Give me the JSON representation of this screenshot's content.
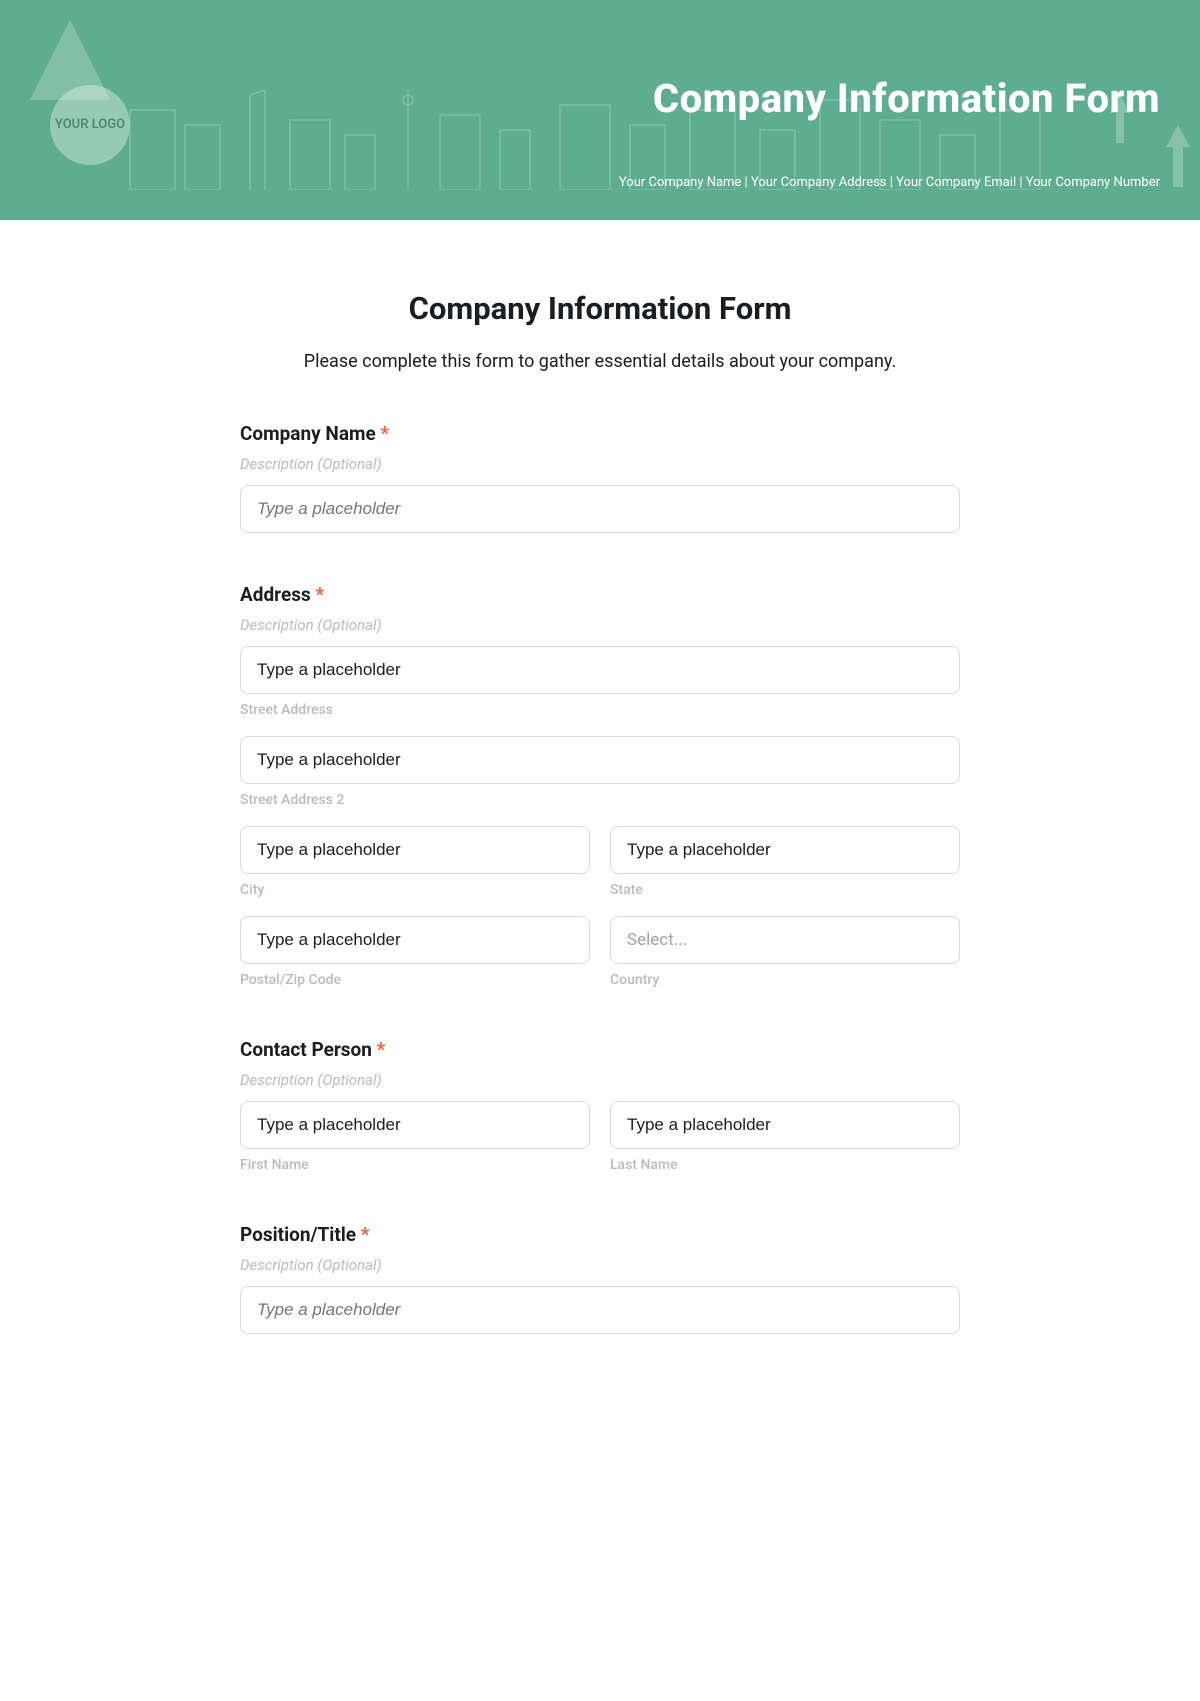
{
  "header": {
    "logo_text": "YOUR LOGO",
    "title": "Company Information Form",
    "subtitle": "Your Company Name |  Your Company Address | Your Company Email | Your Company Number"
  },
  "page": {
    "title": "Company Information Form",
    "subtitle": "Please complete this form to gather essential details about your company."
  },
  "fields": {
    "company_name": {
      "label": "Company Name",
      "desc": "Description (Optional)",
      "placeholder": "Type a placeholder"
    },
    "address": {
      "label": "Address",
      "desc": "Description (Optional)",
      "street1": {
        "value": "Type a placeholder",
        "sub": "Street Address"
      },
      "street2": {
        "value": "Type a placeholder",
        "sub": "Street Address 2"
      },
      "city": {
        "value": "Type a placeholder",
        "sub": "City"
      },
      "state": {
        "value": "Type a placeholder",
        "sub": "State"
      },
      "postal": {
        "value": "Type a placeholder",
        "sub": "Postal/Zip Code"
      },
      "country": {
        "value": "Select...",
        "sub": "Country"
      }
    },
    "contact": {
      "label": "Contact Person",
      "desc": "Description (Optional)",
      "first": {
        "value": "Type a placeholder",
        "sub": "First Name"
      },
      "last": {
        "value": "Type a placeholder",
        "sub": "Last Name"
      }
    },
    "position": {
      "label": "Position/Title",
      "desc": "Description (Optional)",
      "placeholder": "Type a placeholder"
    }
  }
}
